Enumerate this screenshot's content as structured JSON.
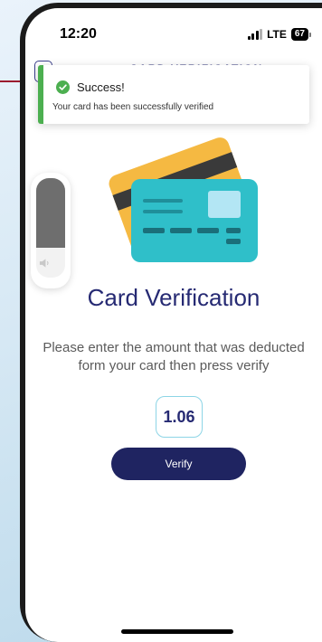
{
  "status_bar": {
    "time": "12:20",
    "network": "LTE",
    "battery": "67"
  },
  "header": {
    "title": "CARD VERIFICATION"
  },
  "toast": {
    "title": "Success!",
    "message": "Your card has been successfully verified",
    "accent_color": "#4caf50"
  },
  "volume_hud": {
    "level": 0.7
  },
  "main": {
    "title": "Card Verification",
    "instructions": "Please enter the amount that was deducted form your card then press verify",
    "amount_value": "1.06",
    "verify_label": "Verify"
  },
  "colors": {
    "brand": "#262a73",
    "button": "#1f2461",
    "card_back": "#f5b942",
    "card_front": "#2fbfc9",
    "card_stripe": "#3a3a3a"
  }
}
